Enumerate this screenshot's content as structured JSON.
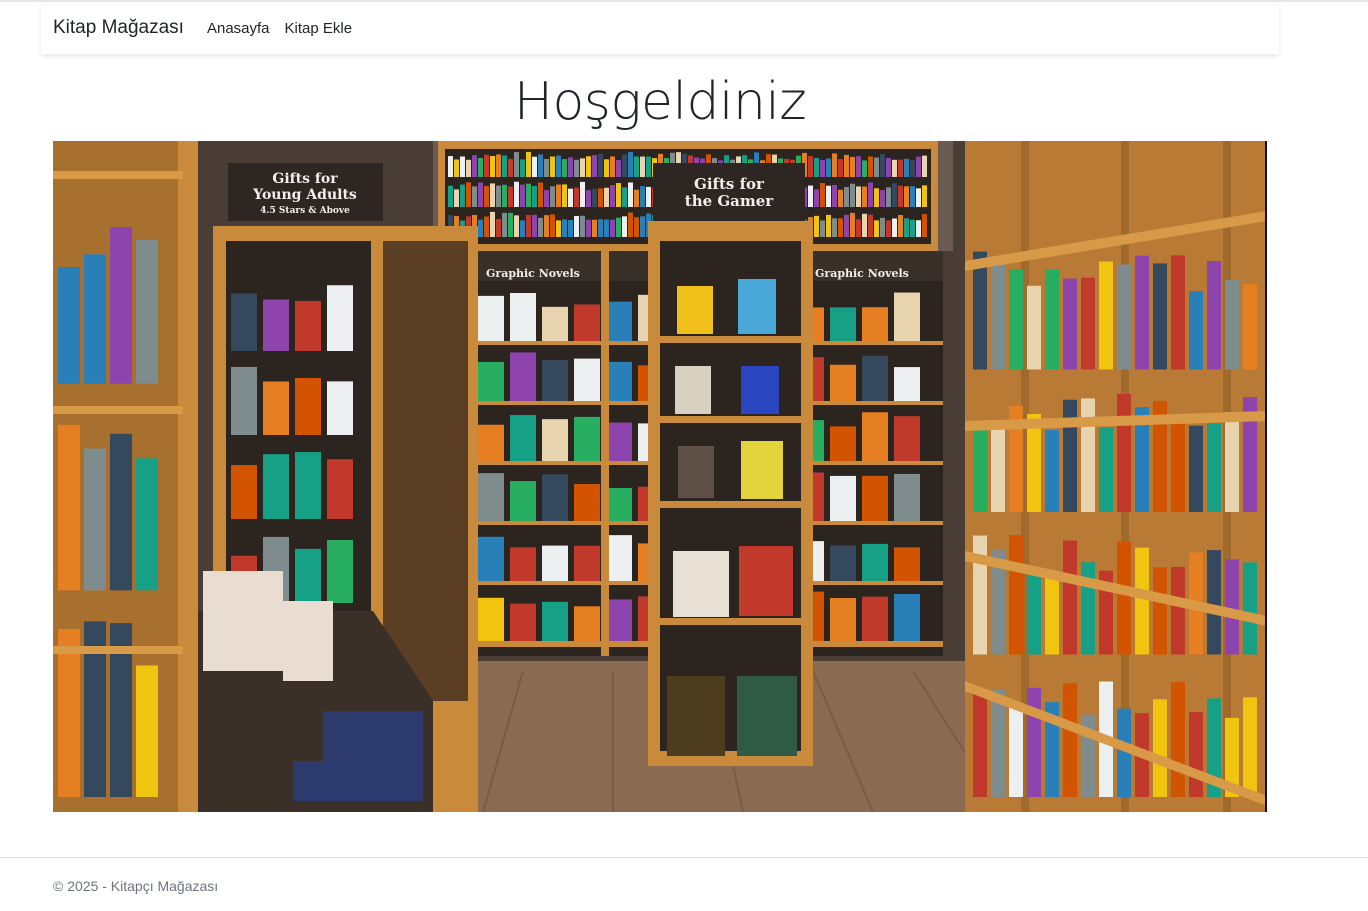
{
  "navbar": {
    "brand": "Kitap Mağazası",
    "links": [
      "Anasayfa",
      "Kitap Ekle"
    ]
  },
  "main": {
    "title": "Hoşgeldiniz",
    "image": {
      "signs": {
        "left_line1": "Gifts for",
        "left_line2": "Young Adults",
        "left_line3": "4.5 Stars & Above",
        "center_line1": "Gifts for",
        "center_line2": "the Gamer",
        "graphic_left": "Graphic Novels",
        "graphic_right": "Graphic Novels"
      }
    }
  },
  "footer": {
    "text": "© 2025 - Kitapçı Mağazası"
  },
  "colors": {
    "wood": "#c98a3c",
    "floor": "#8a6a50",
    "shelf_dark": "#2b241f"
  }
}
